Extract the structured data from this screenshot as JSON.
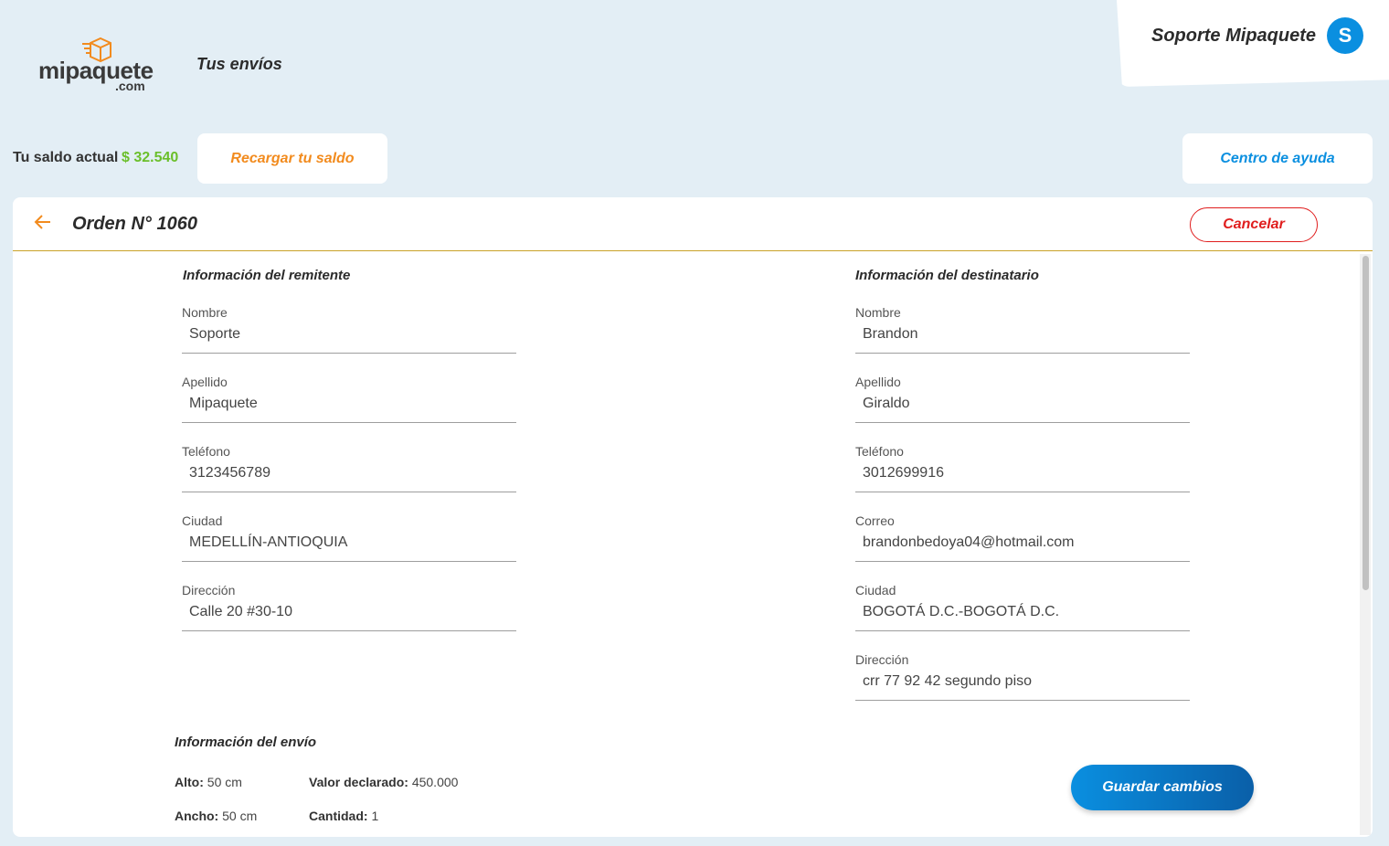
{
  "brand": {
    "logo_main": "mipaquete",
    "logo_suffix": ".com",
    "accent": "#f28b1e"
  },
  "nav": {
    "shipments": "Tus envíos"
  },
  "user": {
    "name": "Soporte Mipaquete",
    "initial": "S"
  },
  "balance": {
    "label": "Tu saldo actual",
    "value": "$ 32.540"
  },
  "actions": {
    "recharge": "Recargar tu saldo",
    "help": "Centro de ayuda"
  },
  "order": {
    "title": "Orden N° 1060",
    "cancel": "Cancelar",
    "save": "Guardar cambios"
  },
  "sender": {
    "title": "Información del remitente",
    "fields": [
      {
        "label": "Nombre",
        "value": "Soporte"
      },
      {
        "label": "Apellido",
        "value": "Mipaquete"
      },
      {
        "label": "Teléfono",
        "value": "3123456789"
      },
      {
        "label": "Ciudad",
        "value": "MEDELLÍN-ANTIOQUIA"
      },
      {
        "label": "Dirección",
        "value": "Calle 20 #30-10"
      }
    ]
  },
  "recipient": {
    "title": "Información del destinatario",
    "fields": [
      {
        "label": "Nombre",
        "value": "Brandon"
      },
      {
        "label": "Apellido",
        "value": "Giraldo"
      },
      {
        "label": "Teléfono",
        "value": "3012699916"
      },
      {
        "label": "Correo",
        "value": "brandonbedoya04@hotmail.com"
      },
      {
        "label": "Ciudad",
        "value": "BOGOTÁ D.C.-BOGOTÁ D.C."
      },
      {
        "label": "Dirección",
        "value": "crr 77 92 42  segundo piso"
      }
    ]
  },
  "shipment": {
    "title": "Información del envío",
    "items": [
      {
        "label": "Alto:",
        "value": "50 cm"
      },
      {
        "label": "Valor declarado:",
        "value": "450.000"
      },
      {
        "label": "Ancho:",
        "value": "50 cm"
      },
      {
        "label": "Cantidad:",
        "value": "1"
      }
    ]
  }
}
